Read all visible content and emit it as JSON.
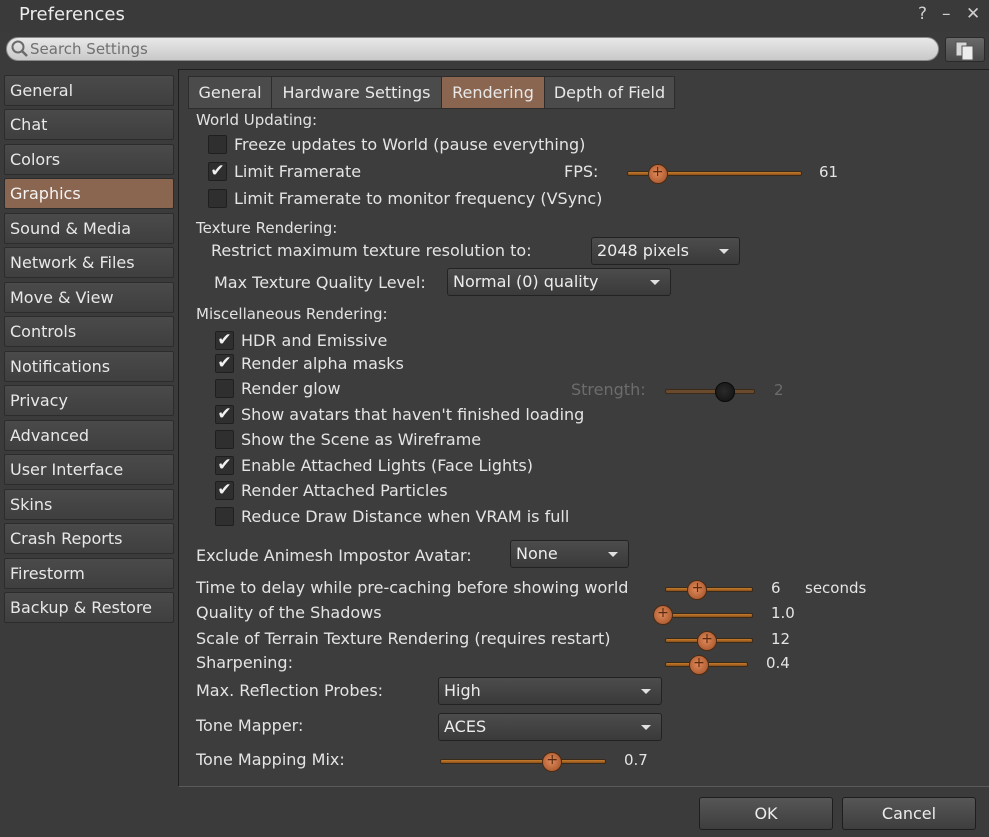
{
  "window": {
    "title": "Preferences",
    "help_icon": "?",
    "minimize_icon": "–",
    "close_icon": "✕"
  },
  "search": {
    "placeholder": "Search Settings",
    "value": ""
  },
  "sidebar": {
    "items": [
      {
        "label": "General"
      },
      {
        "label": "Chat"
      },
      {
        "label": "Colors"
      },
      {
        "label": "Graphics",
        "active": true
      },
      {
        "label": "Sound & Media"
      },
      {
        "label": "Network & Files"
      },
      {
        "label": "Move & View"
      },
      {
        "label": "Controls"
      },
      {
        "label": "Notifications"
      },
      {
        "label": "Privacy"
      },
      {
        "label": "Advanced"
      },
      {
        "label": "User Interface"
      },
      {
        "label": "Skins"
      },
      {
        "label": "Crash Reports"
      },
      {
        "label": "Firestorm"
      },
      {
        "label": "Backup & Restore"
      }
    ]
  },
  "tabs": [
    {
      "label": "General"
    },
    {
      "label": "Hardware Settings"
    },
    {
      "label": "Rendering",
      "active": true
    },
    {
      "label": "Depth of Field"
    }
  ],
  "world_updating": {
    "heading": "World Updating:",
    "freeze": {
      "label": "Freeze updates to World (pause everything)",
      "checked": false
    },
    "limit_framerate": {
      "label": "Limit Framerate",
      "checked": true
    },
    "fps_label": "FPS:",
    "fps_value": "61",
    "fps_fraction": 0.12,
    "vsync": {
      "label": "Limit Framerate to monitor frequency (VSync)",
      "checked": false
    }
  },
  "texture": {
    "heading": "Texture Rendering:",
    "restrict_label": "Restrict maximum texture resolution to:",
    "restrict_value": "2048 pixels",
    "quality_label": "Max Texture Quality Level:",
    "quality_value": "Normal (0) quality"
  },
  "misc": {
    "heading": "Miscellaneous Rendering:",
    "options": [
      {
        "label": "HDR and Emissive",
        "checked": true
      },
      {
        "label": "Render alpha masks",
        "checked": true
      },
      {
        "label": "Render glow",
        "checked": false
      },
      {
        "label": "Show avatars that haven't finished loading",
        "checked": true
      },
      {
        "label": "Show the Scene as Wireframe",
        "checked": false
      },
      {
        "label": "Enable Attached Lights (Face Lights)",
        "checked": true
      },
      {
        "label": "Render Attached Particles",
        "checked": true
      },
      {
        "label": "Reduce Draw Distance when VRAM is full",
        "checked": false
      }
    ],
    "strength_label": "Strength:",
    "strength_value": "2",
    "strength_fraction": 0.68
  },
  "impostor": {
    "label": "Exclude Animesh Impostor Avatar:",
    "value": "None"
  },
  "sliders": {
    "precache": {
      "label": "Time to delay while pre-caching before showing world",
      "value": "6",
      "unit": "seconds",
      "fraction": 0.33
    },
    "shadows": {
      "label": "Quality of the Shadows",
      "value": "1.0",
      "fraction": 0.0
    },
    "terrain": {
      "label": "Scale of Terrain Texture Rendering (requires restart)",
      "value": "12",
      "fraction": 0.47
    },
    "sharpening": {
      "label": "Sharpening:",
      "value": "0.4",
      "fraction": 0.38
    }
  },
  "reflection": {
    "label": "Max. Reflection Probes:",
    "value": "High"
  },
  "tone_mapper": {
    "label": "Tone Mapper:",
    "value": "ACES"
  },
  "tone_mix": {
    "label": "Tone Mapping Mix:",
    "value": "0.7",
    "fraction": 0.7
  },
  "buttons": {
    "ok": "OK",
    "cancel": "Cancel"
  }
}
